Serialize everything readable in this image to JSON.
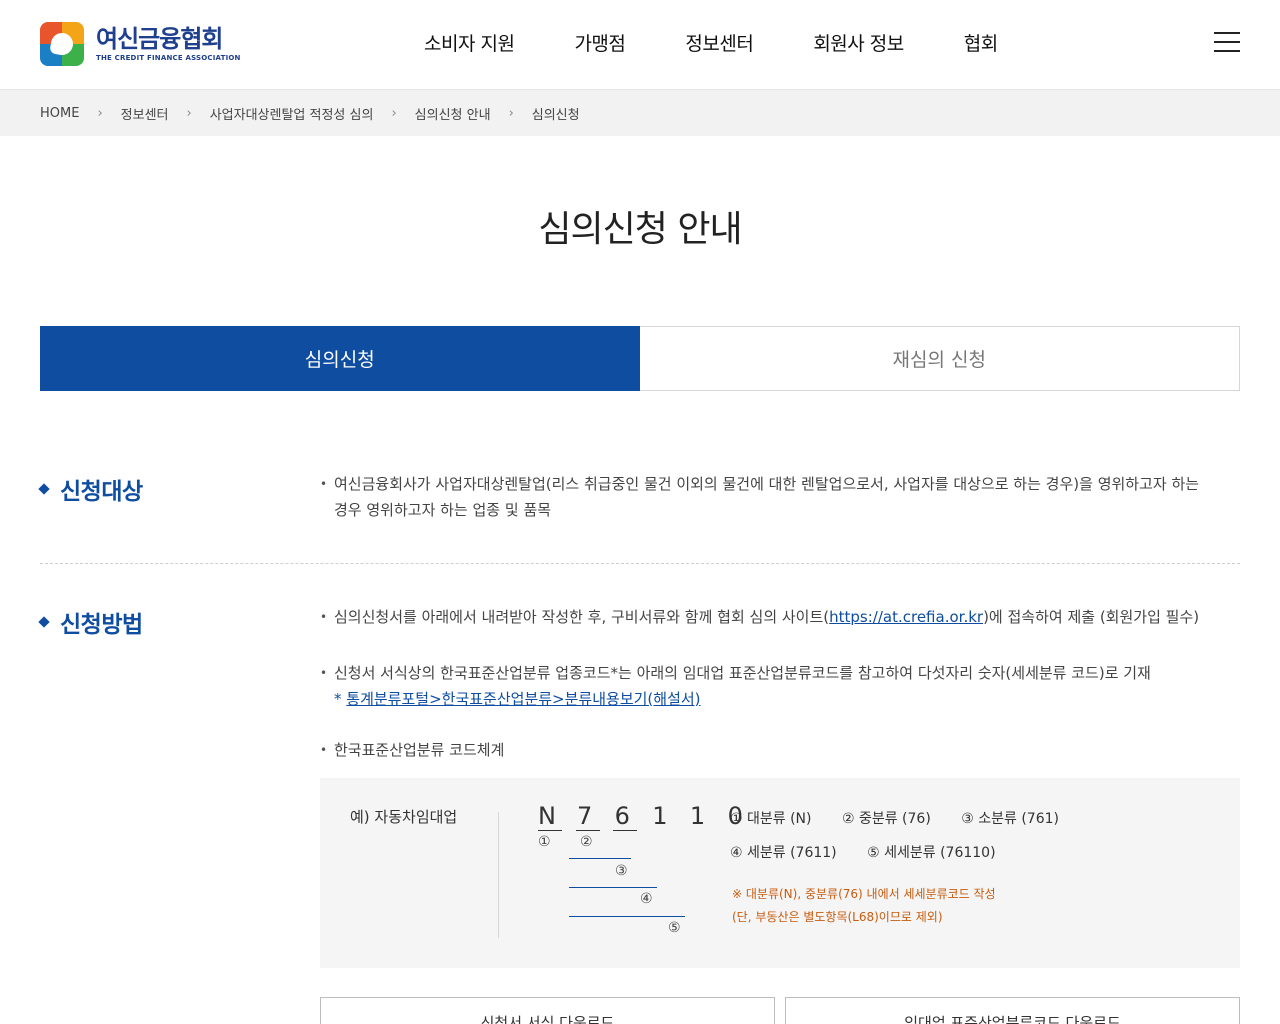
{
  "header": {
    "logo_ko": "여신금융협회",
    "logo_en": "THE CREDIT FINANCE ASSOCIATION",
    "nav": [
      "소비자 지원",
      "가맹점",
      "정보센터",
      "회원사 정보",
      "협회"
    ],
    "menu_icon": "hamburger-icon"
  },
  "breadcrumb": [
    "HOME",
    "정보센터",
    "사업자대상렌탈업 적정성 심의",
    "심의신청 안내",
    "심의신청"
  ],
  "page_title": "심의신청 안내",
  "tabs": [
    {
      "label": "심의신청",
      "active": true
    },
    {
      "label": "재심의 신청",
      "active": false
    }
  ],
  "section1": {
    "title": "신청대상",
    "text": "여신금융회사가 사업자대상렌탈업(리스 취급중인 물건 이외의 물건에 대한 렌탈업으로서, 사업자를 대상으로 하는 경우)을 영위하고자 하는 경우 영위하고자 하는 업종 및 품목"
  },
  "section2": {
    "title": "신청방법",
    "item1_pre": "심의신청서를 아래에서 내려받아 작성한 후, 구비서류와 함께 협회 심의 사이트(",
    "item1_link": "https://at.crefia.or.kr",
    "item1_post": ")에 접속하여 제출 (회원가입 필수)",
    "item2": "신청서 서식상의 한국표준산업분류 업종코드*는 아래의 임대업 표준산업분류코드를 참고하여 다섯자리 숫자(세세분류 코드)로 기재",
    "item2_star": "* ",
    "item2_link": "통계분류포털>한국표준산업분류>분류내용보기(해설서)",
    "item3": "한국표준산업분류 코드체계"
  },
  "code_box": {
    "example": "예) 자동차임대업",
    "letters": [
      "N",
      "7",
      "6",
      "1",
      "1",
      "0"
    ],
    "circles": [
      "①",
      "②",
      "③",
      "④",
      "⑤"
    ],
    "legend_row1": [
      "① 대분류 (N)",
      "② 중분류 (76)",
      "③ 소분류 (761)"
    ],
    "legend_row2": [
      "④ 세분류 (7611)",
      "⑤ 세세분류 (76110)"
    ],
    "note1": "※ 대분류(N), 중분류(76) 내에서 세세분류코드 작성",
    "note2": "(단, 부동산은 별도항목(L68)이므로 제외)"
  },
  "downloads": [
    "신청서 서식 다운로드",
    "임대업 표준산업분류코드 다운로드"
  ],
  "colors": {
    "primary": "#0f4da1",
    "note": "#c85c0e",
    "breadcrumb_bg": "#f2f2f2",
    "box_bg": "#f5f5f5"
  }
}
